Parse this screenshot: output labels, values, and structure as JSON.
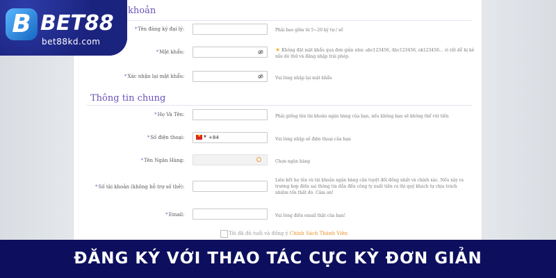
{
  "brand": {
    "logo_letter": "B",
    "name": "BET88",
    "domain": "bet88kd.com"
  },
  "account_section": {
    "title": "khoản",
    "fields": [
      {
        "label": "Tên đăng ký đại lý",
        "value": "",
        "hint": "Phải bao gồm từ 5~20 ký tự / số"
      },
      {
        "label": "Mật khẩu",
        "value": "",
        "hint": "Không đặt mật khẩu quá đơn giản như: abc123456, Abc123456, ok123456… vì rất dễ bị kẻ xấu dò thử và đăng nhập trái phép.",
        "hint_icon": "star-icon"
      },
      {
        "label": "Xác nhận lại mật khẩu",
        "value": "",
        "hint": "Vui lòng nhập lại mật khẩu"
      }
    ]
  },
  "general_section": {
    "title": "Thông tin chung",
    "fields": [
      {
        "label": "Họ Và Tên",
        "value": "",
        "hint": "Phải giống tên tài khoản ngân hàng của bạn, nếu không bạn sẽ không thể rút tiền"
      },
      {
        "label": "Số điện thoại",
        "value": "+84",
        "hint": "Vui lòng nhập số điện thoại của bạn"
      },
      {
        "label": "Tên Ngân Hàng",
        "value": "",
        "hint": "Chọn ngân hàng"
      },
      {
        "label": "Số tài khoản (không hỗ trợ số thẻ)",
        "value": "",
        "hint": "Liên kết họ tên và tài khoản ngân hàng cần tuyệt đối đồng nhất và chính xác. Nếu xảy ra trường hợp điền sai thông tin dẫn đến công ty xuất tiền ra thì quý khách tự chịu trách nhiệm tốn thất đó. Cảm ơn!"
      },
      {
        "label": "Email",
        "value": "",
        "hint": "Vui lòng điền email thật của bạn!"
      }
    ]
  },
  "agreement": {
    "text": "Tôi đã đủ tuổi và đồng ý ",
    "link": "Chính Sách Thành Viên"
  },
  "banner": {
    "text": "ĐĂNG KÝ VỚI THAO TÁC CỰC KỲ ĐƠN GIẢN"
  },
  "colors": {
    "accent": "#6a52b8",
    "banner_bg": "#0d0f5e",
    "link": "#e8902a"
  }
}
